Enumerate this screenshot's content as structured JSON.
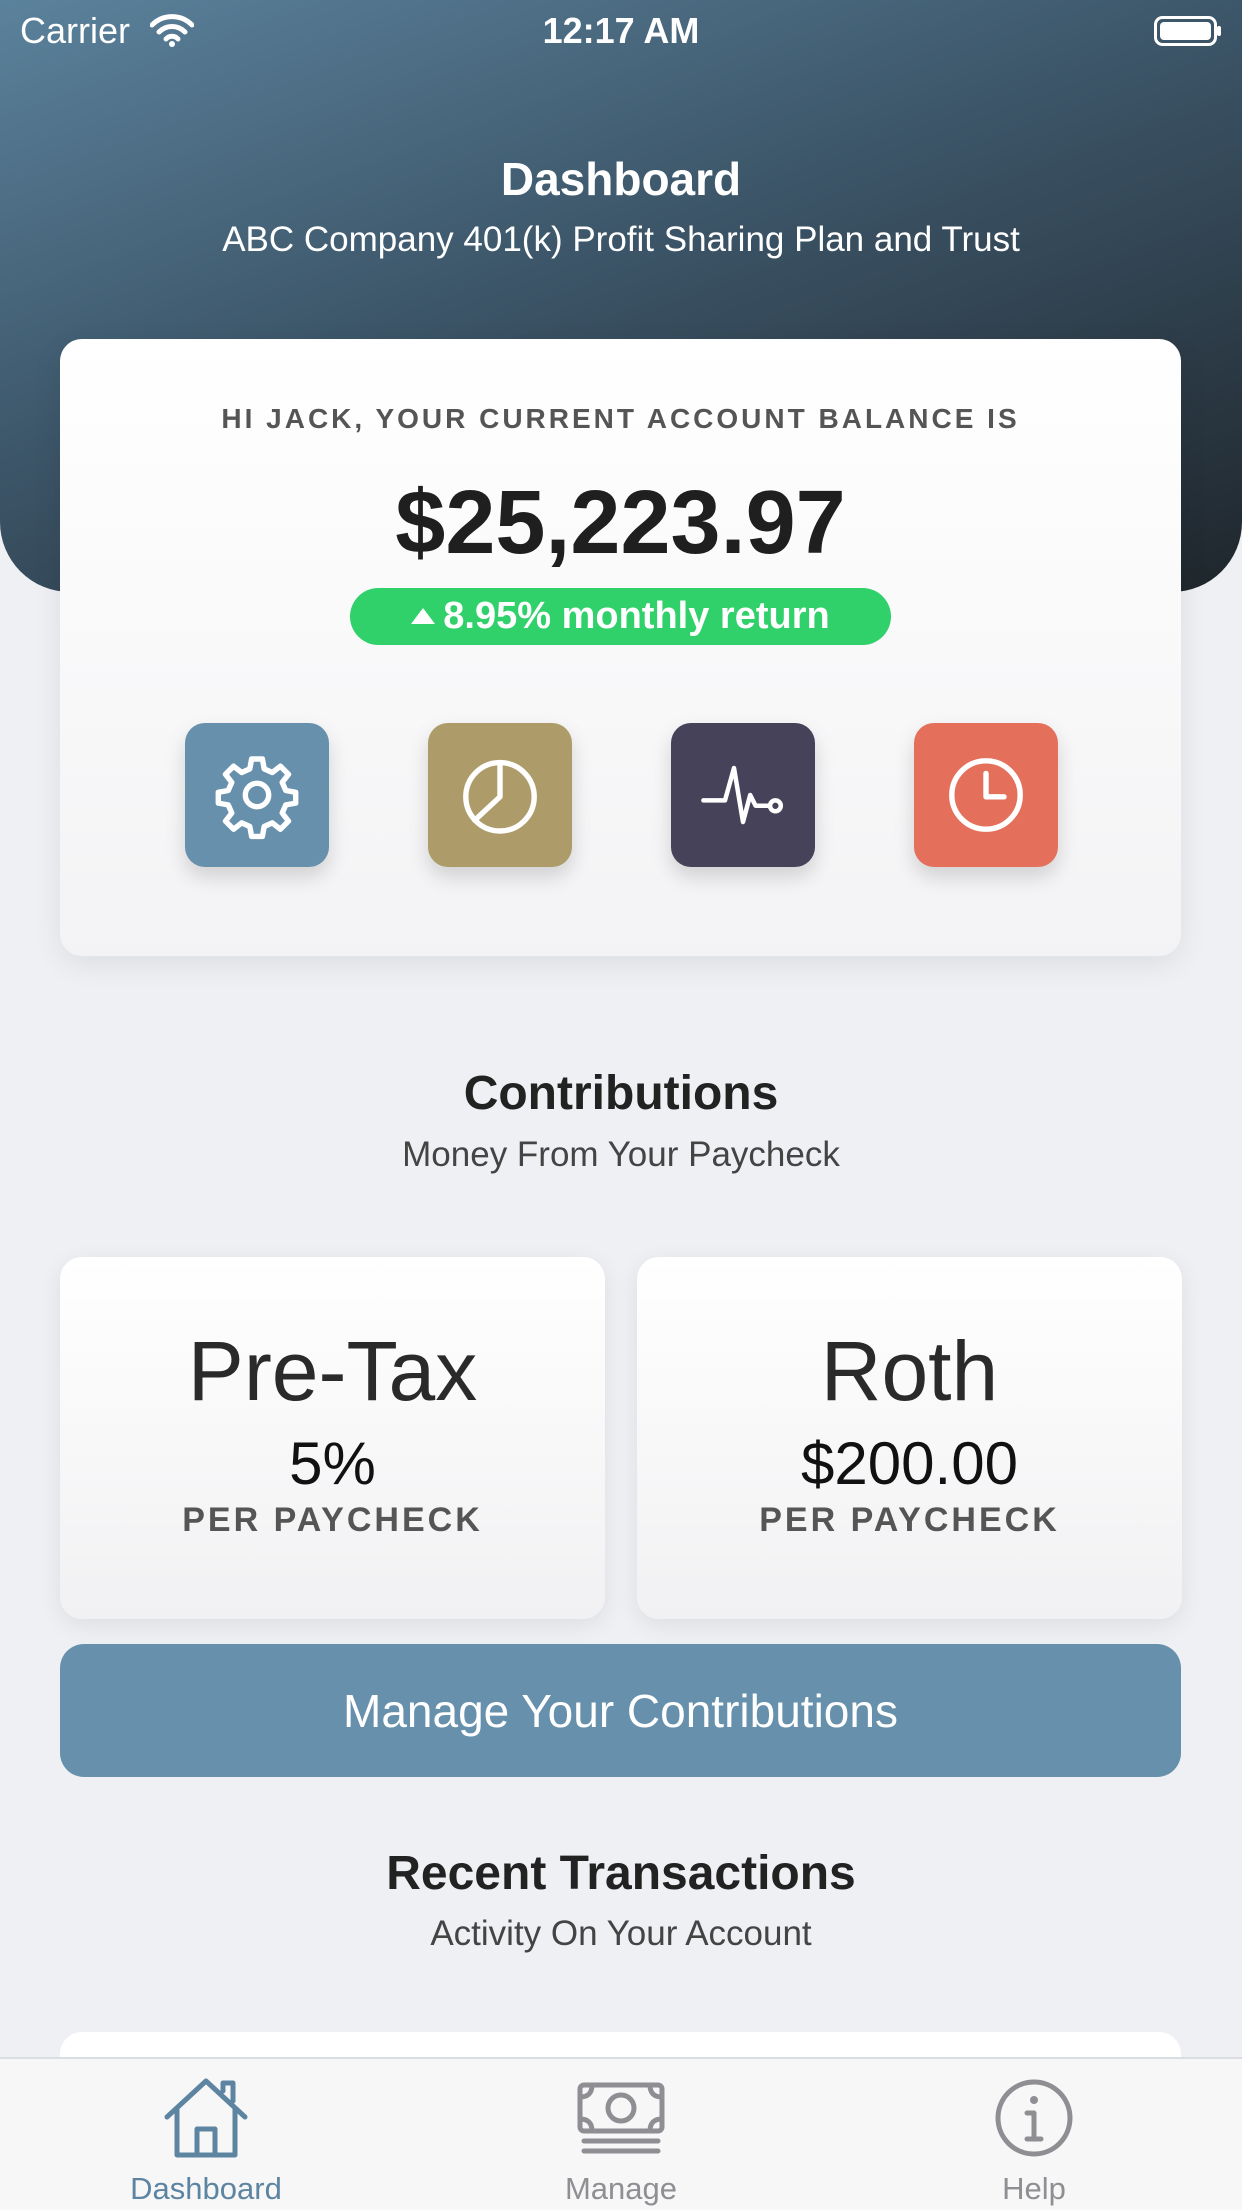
{
  "status_bar": {
    "carrier": "Carrier",
    "time": "12:17 AM"
  },
  "header": {
    "title": "Dashboard",
    "subtitle": "ABC Company 401(k) Profit Sharing Plan and Trust"
  },
  "balance": {
    "greeting": "HI JACK, YOUR CURRENT ACCOUNT BALANCE IS",
    "amount": "$25,223.97",
    "return_text": "8.95% monthly return",
    "return_direction": "up",
    "return_color": "#30d16a"
  },
  "quick_actions": [
    {
      "icon": "gear-icon",
      "color": "#6790ac"
    },
    {
      "icon": "pie-chart-icon",
      "color": "#ad9c6a"
    },
    {
      "icon": "activity-pulse-icon",
      "color": "#45425a"
    },
    {
      "icon": "clock-icon",
      "color": "#e4705c"
    }
  ],
  "contributions": {
    "title": "Contributions",
    "subtitle": "Money From Your Paycheck",
    "cards": [
      {
        "label": "Pre-Tax",
        "value": "5%",
        "unit": "PER PAYCHECK"
      },
      {
        "label": "Roth",
        "value": "$200.00",
        "unit": "PER PAYCHECK"
      }
    ],
    "button_label": "Manage Your Contributions",
    "button_color": "#6790ac"
  },
  "transactions": {
    "title": "Recent Transactions",
    "subtitle": "Activity On Your Account"
  },
  "tab_bar": {
    "active_color": "#5d84a0",
    "inactive_color": "#8e8e93",
    "tabs": [
      {
        "label": "Dashboard",
        "icon": "home-icon",
        "active": true
      },
      {
        "label": "Manage",
        "icon": "money-icon",
        "active": false
      },
      {
        "label": "Help",
        "icon": "info-icon",
        "active": false
      }
    ]
  }
}
